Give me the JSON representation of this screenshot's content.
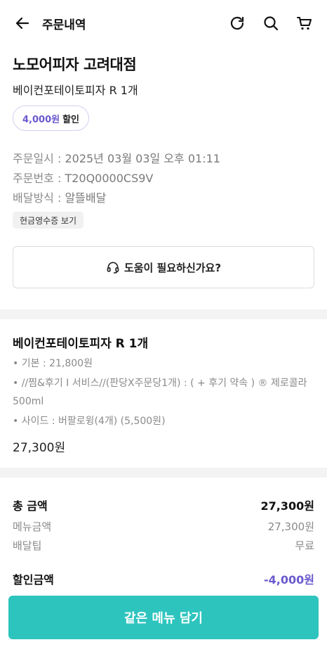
{
  "header": {
    "title": "주문내역"
  },
  "store": {
    "name": "노모어피자 고려대점",
    "menu_summary": "베이컨포테이토피자 R 1개"
  },
  "discount_badge": {
    "amount": "4,000원",
    "label": "할인"
  },
  "order_info": {
    "date_label": "주문일시 : ",
    "date_value": "2025년 03월 03일 오후 01:11",
    "number_label": "주문번호 : ",
    "number_value": "T20Q0000CS9V",
    "delivery_label": "배달방식 : ",
    "delivery_value": "알뜰배달"
  },
  "receipt_label": "현금영수증 보기",
  "help_label": "도움이 필요하신가요?",
  "item": {
    "title": "베이컨포테이토피자 R 1개",
    "option_base": "• 기본 : 21,800원",
    "option_service": "• //찜&후기 I 서비스//(판당X주문당1개) : ( + 후기 약속 ) ® 제로콜라 500ml",
    "option_side": "• 사이드 : 버팔로윙(4개) (5,500원)",
    "price": "27,300원"
  },
  "summary": {
    "total_label": "총 금액",
    "total_value": "27,300원",
    "menu_label": "메뉴금액",
    "menu_value": "27,300원",
    "tip_label": "배달팁",
    "tip_value": "무료",
    "discount_label": "할인금액",
    "discount_value": "-4,000원"
  },
  "cta_label": "같은 메뉴 담기",
  "colors": {
    "accent_purple": "#6a5acd",
    "cta_teal": "#2ec4be"
  }
}
